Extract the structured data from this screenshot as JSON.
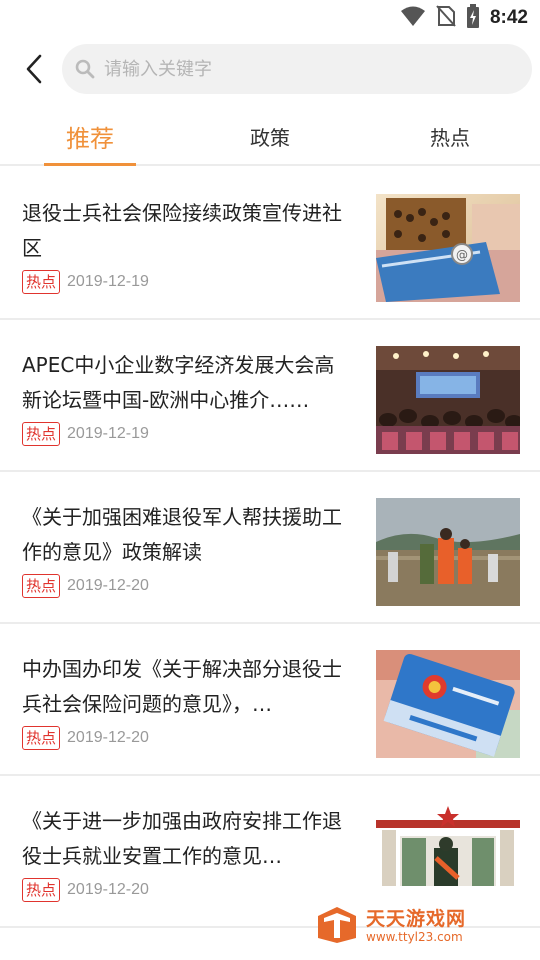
{
  "status_bar": {
    "time": "8:42",
    "icons": [
      "wifi-icon",
      "no-sim-icon",
      "battery-charging-icon"
    ]
  },
  "search": {
    "placeholder": "请输入关键字",
    "value": ""
  },
  "tabs": [
    {
      "label": "推荐",
      "active": true
    },
    {
      "label": "政策",
      "active": false
    },
    {
      "label": "热点",
      "active": false
    }
  ],
  "news": [
    {
      "title": "退役士兵社会保险接续政策宣传进社区",
      "badge": "热点",
      "date": "2019-12-19",
      "image": "abacus-social-security-card"
    },
    {
      "title": "APEC中小企业数字经济发展大会高新论坛暨中国-欧洲中心推介……",
      "badge": "热点",
      "date": "2019-12-19",
      "image": "conference-hall"
    },
    {
      "title": "《关于加强困难退役军人帮扶援助工作的意见》政策解读",
      "badge": "热点",
      "date": "2019-12-20",
      "image": "flood-rescue"
    },
    {
      "title": "中办国办印发《关于解决部分退役士兵社会保险问题的意见》，…",
      "badge": "热点",
      "date": "2019-12-20",
      "image": "social-security-card"
    },
    {
      "title": "《关于进一步加强由政府安排工作退役士兵就业安置工作的意见…",
      "badge": "热点",
      "date": "2019-12-20",
      "image": "soldier-salute-gate"
    }
  ],
  "watermark": {
    "title": "天天游戏网",
    "url": "www.ttyl23.com"
  },
  "colors": {
    "accent": "#f0913a",
    "hot_badge": "#e0342e",
    "date": "#999999"
  }
}
